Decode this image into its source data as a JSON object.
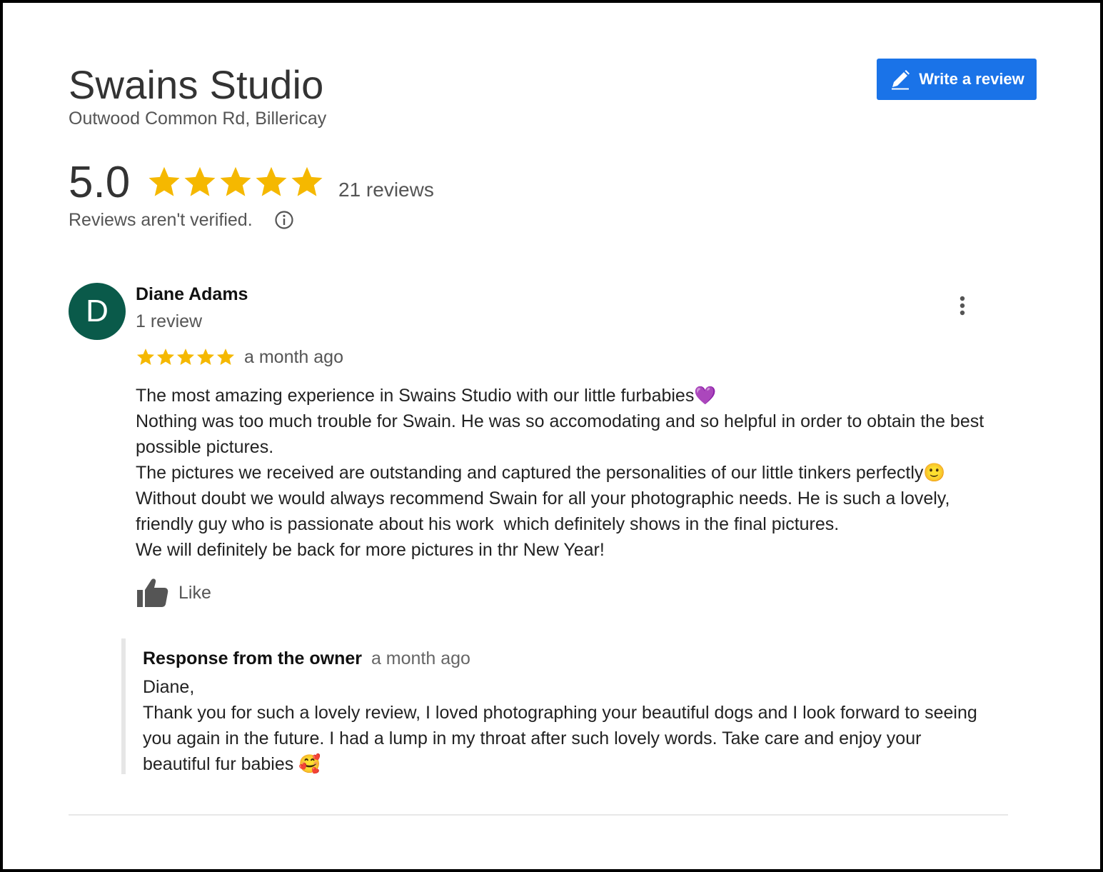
{
  "business": {
    "name": "Swains Studio",
    "address": "Outwood Common Rd, Billericay",
    "rating": "5.0",
    "rating_stars": 5,
    "review_count": "21 reviews",
    "verification_note": "Reviews aren't verified."
  },
  "actions": {
    "write_review_label": "Write a review"
  },
  "review": {
    "avatar_letter": "D",
    "reviewer_name": "Diane Adams",
    "reviewer_meta": "1 review",
    "stars": 5,
    "time": "a month ago",
    "text": "The most amazing experience in Swains Studio with our little furbabies💜\nNothing was too much trouble for Swain. He was so accomodating and so helpful in order to obtain the best possible pictures.\nThe pictures we received are outstanding and captured the personalities of our little tinkers perfectly🙂\nWithout doubt we would always recommend Swain for all your photographic needs. He is such a lovely, friendly guy who is passionate about his work  which definitely shows in the final pictures.\nWe will definitely be back for more pictures in thr New Year!",
    "like_label": "Like"
  },
  "owner_response": {
    "title": "Response from the owner",
    "time": "a month ago",
    "text": "Diane,\nThank you for such a lovely review, I loved photographing your beautiful dogs and I look forward to seeing you again in the future. I had a lump in my throat after such lovely words. Take care and enjoy your beautiful fur babies 🥰"
  },
  "colors": {
    "star": "#f5b800",
    "button_blue": "#1a73e8",
    "avatar_bg": "#0a5a4a"
  },
  "icons": {
    "write_review": "pencil-icon",
    "info": "info-icon",
    "more": "more-vertical-icon",
    "like": "thumbs-up-icon",
    "star": "star-icon"
  }
}
